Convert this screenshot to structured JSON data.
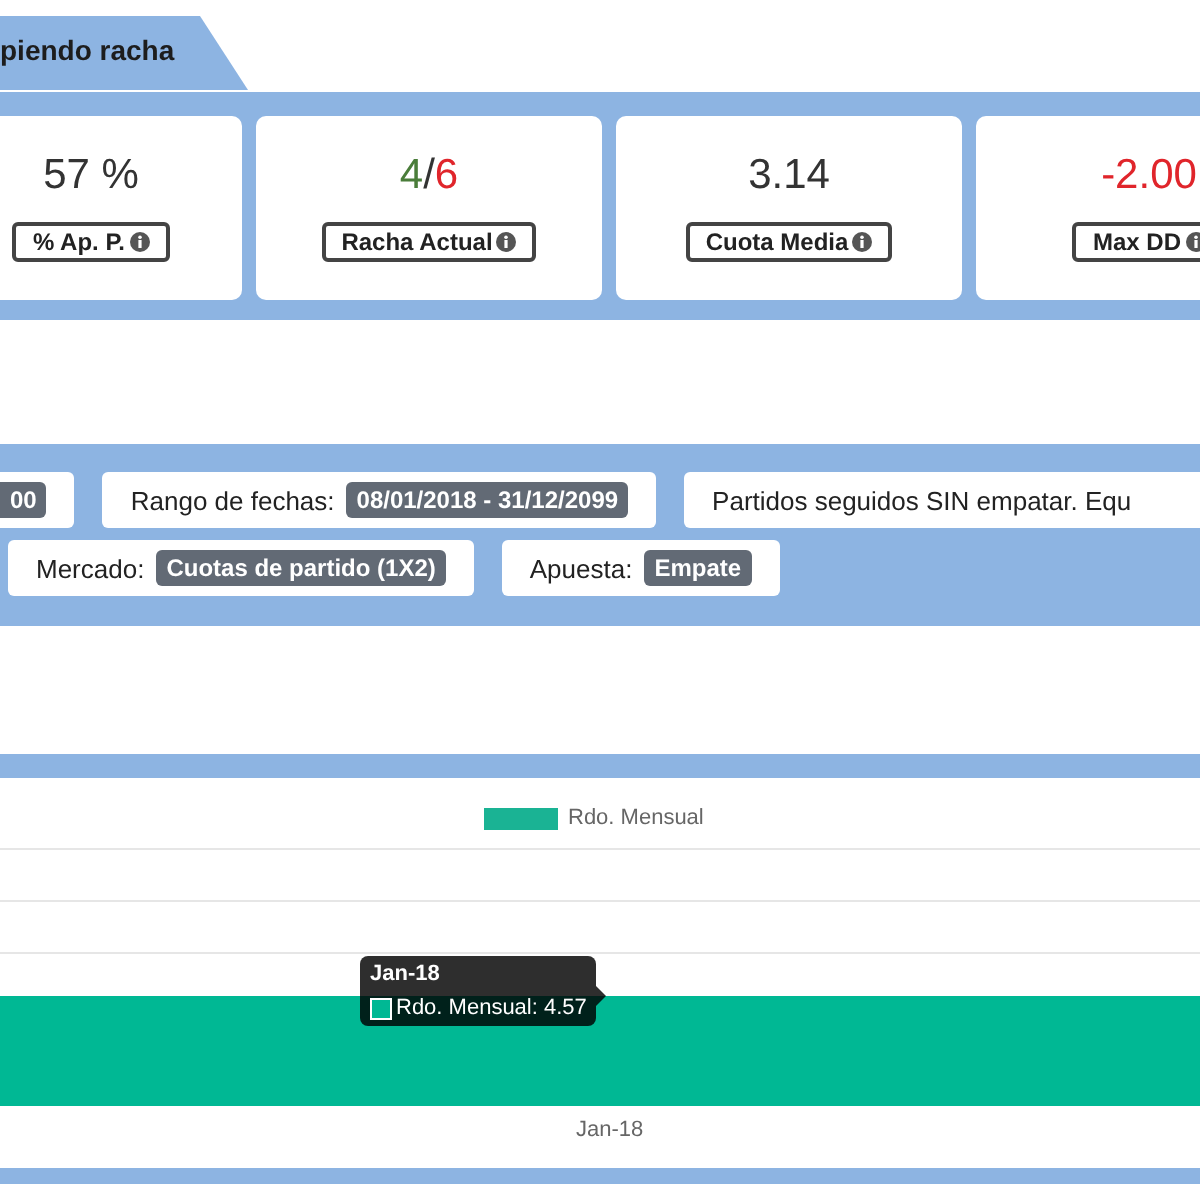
{
  "tab": {
    "label": "piendo racha"
  },
  "stats": [
    {
      "value": [
        {
          "text": "57 %",
          "color": "#333333"
        }
      ],
      "label": "% Ap. P."
    },
    {
      "value": [
        {
          "text": "4",
          "color": "#4a7d3a"
        },
        {
          "text": "/",
          "color": "#333333"
        },
        {
          "text": "6",
          "color": "#e0252b"
        }
      ],
      "label": "Racha Actual"
    },
    {
      "value": [
        {
          "text": "3.14",
          "color": "#333333"
        }
      ],
      "label": "Cuota Media"
    },
    {
      "value": [
        {
          "text": "-2.00",
          "color": "#e0252b"
        }
      ],
      "label": "Max DD"
    }
  ],
  "filters": [
    [
      {
        "value": "00"
      },
      {
        "label": "Rango de fechas:",
        "value": "08/01/2018 - 31/12/2099"
      },
      {
        "label": "Partidos seguidos SIN empatar. Equ"
      }
    ],
    [
      {
        "label": "Mercado:",
        "value": "Cuotas de partido (1X2)"
      },
      {
        "label": "Apuesta:",
        "value": "Empate"
      }
    ]
  ],
  "chart": {
    "legend": "Rdo. Mensual",
    "x_label": "Jan-18",
    "tooltip": {
      "title": "Jan-18",
      "text": "Rdo. Mensual: 4.57"
    }
  }
}
